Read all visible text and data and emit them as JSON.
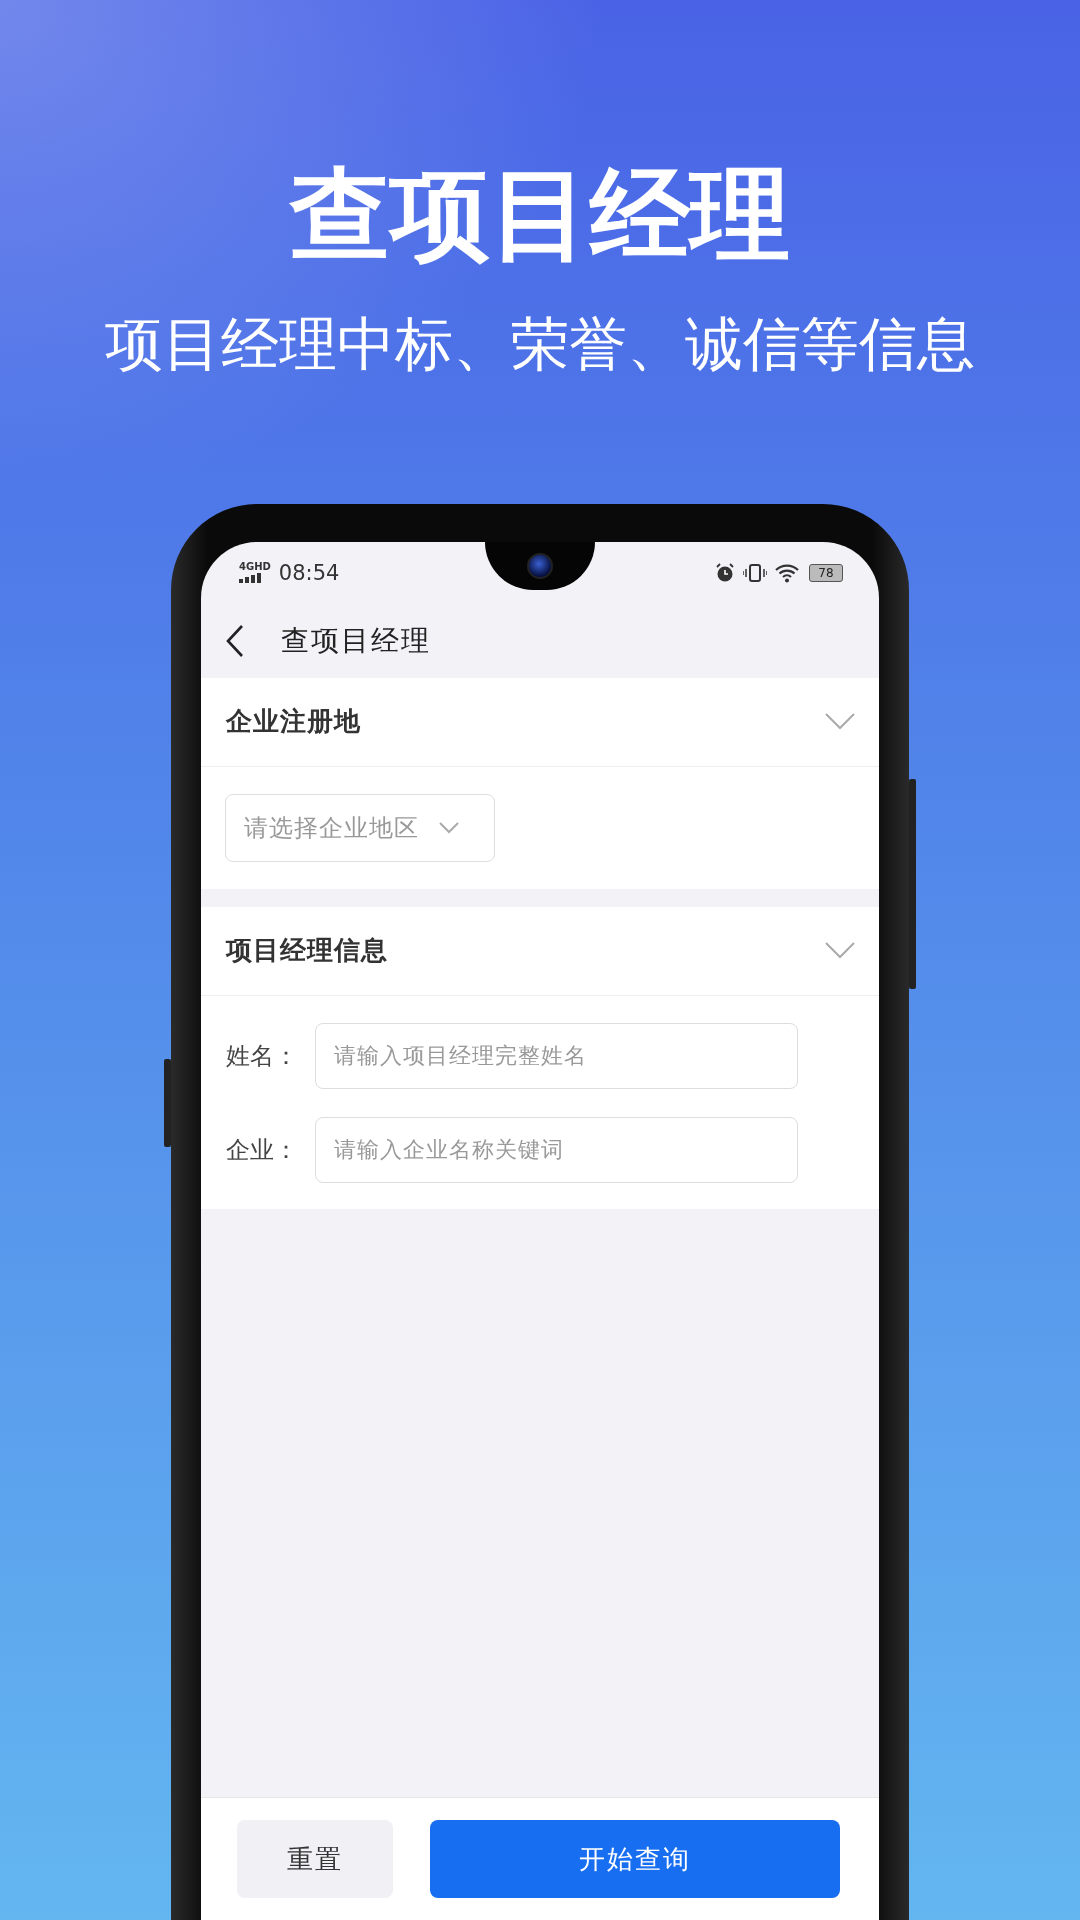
{
  "headline": "查项目经理",
  "subtitle": "项目经理中标、荣誉、诚信等信息",
  "status_bar": {
    "network": "4G",
    "network_badge": "HD",
    "time": "08:54",
    "battery": "78"
  },
  "nav": {
    "title": "查项目经理"
  },
  "sections": [
    {
      "kind": "select",
      "title": "企业注册地",
      "placeholder": "请选择企业地区"
    },
    {
      "kind": "form",
      "title": "项目经理信息",
      "fields": [
        {
          "label": "姓名：",
          "placeholder": "请输入项目经理完整姓名"
        },
        {
          "label": "企业：",
          "placeholder": "请输入企业名称关键词"
        }
      ]
    }
  ],
  "buttons": [
    {
      "kind": "secondary",
      "label": "重置"
    },
    {
      "kind": "primary",
      "label": "开始查询"
    }
  ]
}
